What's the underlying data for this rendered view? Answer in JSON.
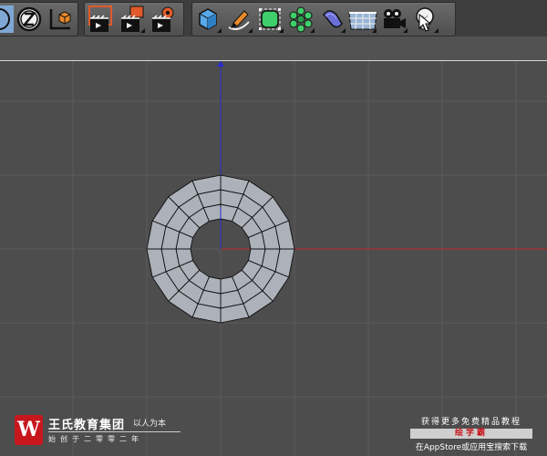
{
  "toolbar": {
    "groups": [
      {
        "name": "coordinate-group",
        "buttons": [
          "coordinate-system-icon",
          "z-axis-lock-icon",
          "world-coordinate-icon"
        ]
      },
      {
        "name": "render-group",
        "buttons": [
          "render-view-icon",
          "render-to-picture-viewer-icon",
          "render-settings-icon"
        ]
      },
      {
        "name": "objects-group",
        "buttons": [
          "cube-icon",
          "pen-spline-icon",
          "subdivision-surface-icon",
          "array-icon",
          "bend-deformer-icon",
          "floor-plane-icon",
          "camera-icon",
          "light-bulb-icon"
        ]
      }
    ]
  },
  "viewport": {
    "axis_colors": {
      "x": "#c02828",
      "y": "#2a2ad0"
    },
    "mesh": {
      "type": "ring",
      "segments": 16,
      "rings": 3,
      "fill": "#adb2ba",
      "stroke": "#111111"
    },
    "grid_color": "#5a5a5a"
  },
  "watermark": {
    "brand_logo": "W",
    "brand_name": "王氏教育集团",
    "brand_slogan": "以人为本",
    "brand_sub": "始创于二零零二年",
    "promo_line1": "获得更多免费精品教程",
    "promo_app": "绘学霸",
    "promo_line3": "在AppStore或应用宝搜索下载"
  }
}
